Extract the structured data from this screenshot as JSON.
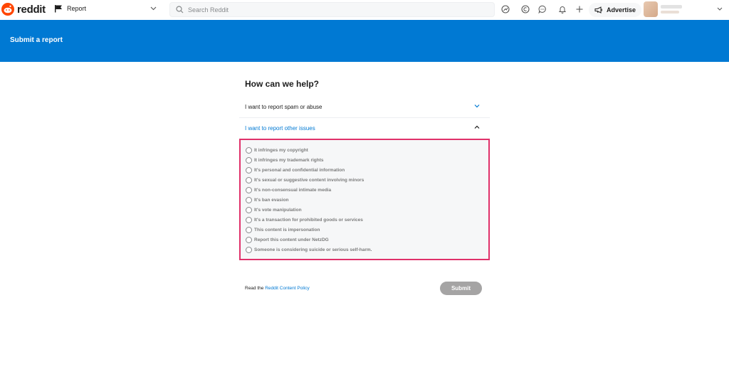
{
  "header": {
    "logo_text": "reddit",
    "community_label": "Report",
    "search": {
      "placeholder": "Search Reddit"
    },
    "advertise_label": "Advertise",
    "icons": [
      "popular-icon",
      "coins-icon",
      "chat-icon",
      "notification-bell-icon",
      "plus-icon"
    ]
  },
  "banner": {
    "title": "Submit a report"
  },
  "form": {
    "heading": "How can we help?",
    "accordions": [
      {
        "label": "I want to report spam or abuse",
        "expanded": false
      },
      {
        "label": "I want to report other issues",
        "expanded": true
      }
    ],
    "options": [
      "It infringes my copyright",
      "It infringes my trademark rights",
      "It's personal and confidential information",
      "It's sexual or suggestive content involving minors",
      "It's non-consensual intimate media",
      "It's ban evasion",
      "It's vote manipulation",
      "It's a transaction for prohibited goods or services",
      "This content is impersonation",
      "Report this content under NetzDG",
      "Someone is considering suicide or serious self-harm."
    ],
    "footer_prefix": "Read the",
    "policy_link": "Reddit Content Policy",
    "submit_label": "Submit"
  },
  "colors": {
    "brand": "#ff4500",
    "banner": "#0079d3",
    "highlight_border": "#e0316a",
    "submit_disabled": "#a5a4a4"
  }
}
